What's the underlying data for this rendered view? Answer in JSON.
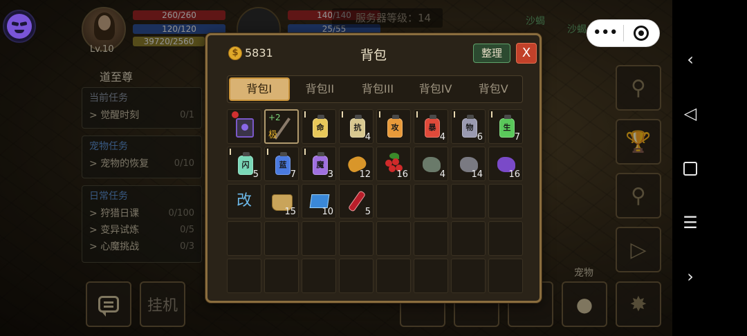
{
  "hud": {
    "level": "Lv.10",
    "hp": "260/260",
    "mp": "120/120",
    "xp": "39720/2560",
    "rank": "道至尊",
    "pet_hp": "140/140",
    "pet_mp": "25/55",
    "server_level": "服务器等级：14",
    "mobs": [
      "沙蝎",
      "沙蝎"
    ]
  },
  "quests": {
    "main": {
      "title": "当前任务",
      "items": [
        {
          "name": "觉醒时刻",
          "count": "0/1"
        }
      ]
    },
    "pet": {
      "title": "宠物任务",
      "items": [
        {
          "name": "宠物的恢复",
          "count": "0/10"
        }
      ]
    },
    "daily": {
      "title": "日常任务",
      "items": [
        {
          "name": "狩猎日课",
          "count": "0/100"
        },
        {
          "name": "变异试炼",
          "count": "0/5"
        },
        {
          "name": "心魔挑战",
          "count": "0/3"
        }
      ]
    }
  },
  "buttons": {
    "chat": "chat",
    "idle": "挂机",
    "pet": "宠物"
  },
  "bag": {
    "gold": "5831",
    "coin_symbol": "$",
    "title": "背包",
    "sort": "整理",
    "close": "X",
    "tabs": [
      "背包I",
      "背包II",
      "背包III",
      "背包IV",
      "背包V"
    ],
    "active_tab": 0,
    "items": [
      {
        "kind": "book",
        "label": "",
        "count": ""
      },
      {
        "kind": "staff",
        "plus": "+2",
        "grade": "极",
        "count": ""
      },
      {
        "kind": "jar",
        "label": "命",
        "color": "#e8c85a",
        "count": ""
      },
      {
        "kind": "jar",
        "label": "抗",
        "color": "#d8c890",
        "count": "4"
      },
      {
        "kind": "jar",
        "label": "攻",
        "color": "#e89a3a",
        "count": ""
      },
      {
        "kind": "jar",
        "label": "暴",
        "color": "#e04a3a",
        "count": "4"
      },
      {
        "kind": "jar",
        "label": "物",
        "color": "#9a9ab0",
        "count": "6"
      },
      {
        "kind": "jar",
        "label": "生",
        "color": "#5ac85a",
        "count": "7"
      },
      {
        "kind": "jar",
        "label": "闪",
        "color": "#7ad8b8",
        "count": "5"
      },
      {
        "kind": "jar",
        "label": "蓝",
        "color": "#4a7ae0",
        "count": "7"
      },
      {
        "kind": "jar",
        "label": "魔",
        "color": "#a070e0",
        "count": "3"
      },
      {
        "kind": "bread",
        "count": "12"
      },
      {
        "kind": "berries",
        "count": "16"
      },
      {
        "kind": "ore",
        "color": "#6a7a6a",
        "count": "4"
      },
      {
        "kind": "ore",
        "color": "#7a7a82",
        "count": "14"
      },
      {
        "kind": "ore",
        "color": "#7a4ac8",
        "count": "16"
      },
      {
        "kind": "text",
        "label": "改",
        "count": ""
      },
      {
        "kind": "pouch",
        "count": "15"
      },
      {
        "kind": "map",
        "count": "10"
      },
      {
        "kind": "vial",
        "count": "5"
      }
    ],
    "total_slots": 40
  }
}
